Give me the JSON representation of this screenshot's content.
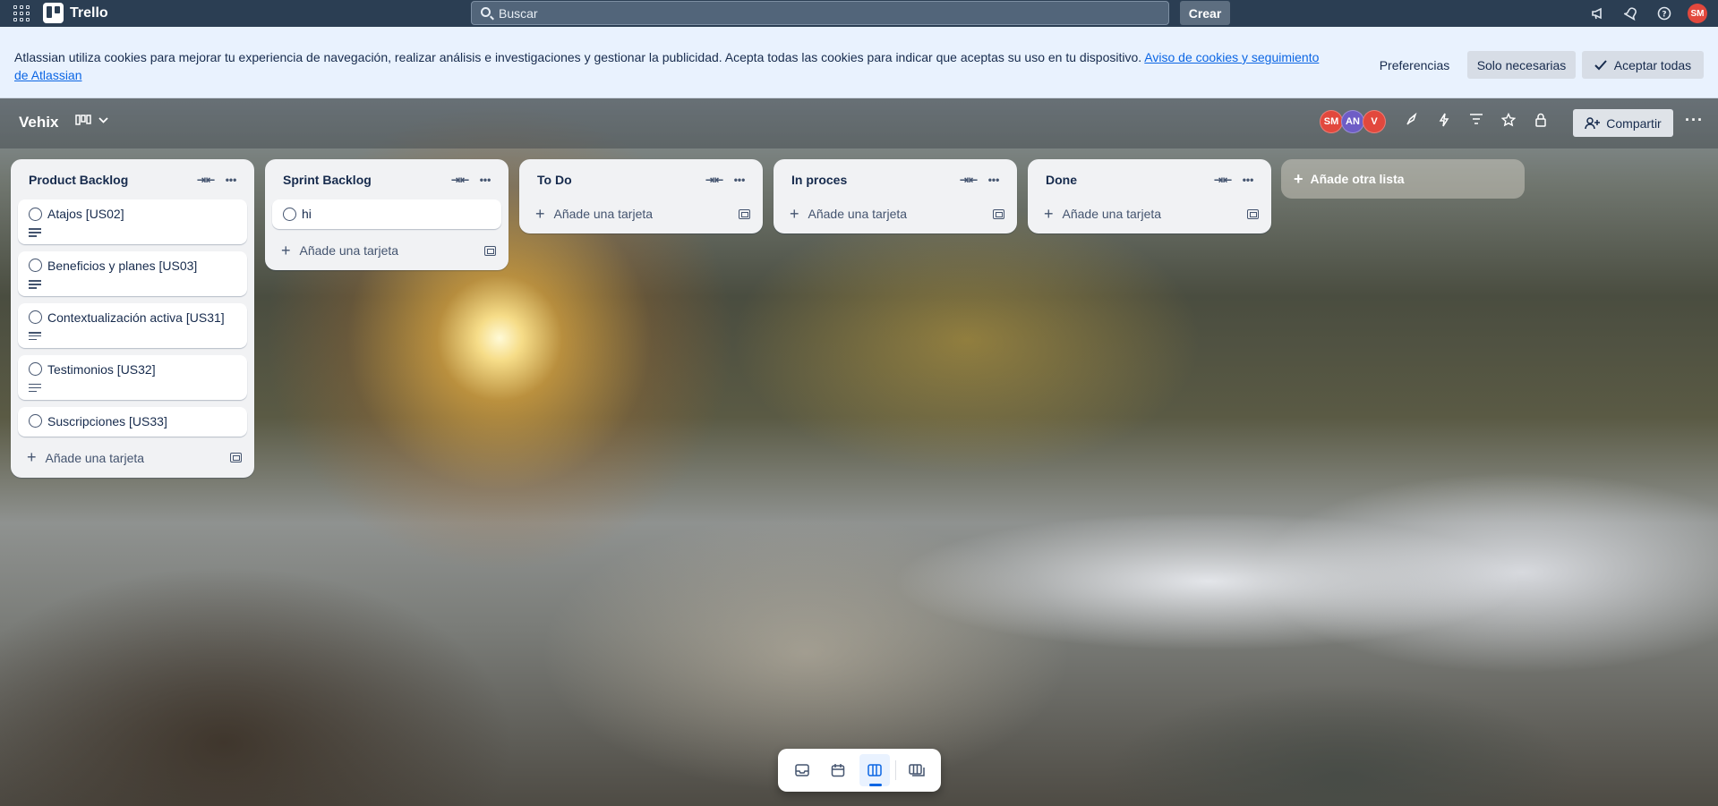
{
  "app": {
    "name": "Trello"
  },
  "search": {
    "placeholder": "Buscar"
  },
  "create_label": "Crear",
  "user_initials": "SM",
  "cookie": {
    "text": "Atlassian utiliza cookies para mejorar tu experiencia de navegación, realizar análisis e investigaciones y gestionar la publicidad. Acepta todas las cookies para indicar que aceptas su uso en tu dispositivo.",
    "link": "Aviso de cookies y seguimiento de Atlassian",
    "preferences": "Preferencias",
    "necessary": "Solo necesarias",
    "accept_all": "Aceptar todas"
  },
  "board": {
    "title": "Vehix",
    "members": [
      {
        "initials": "SM",
        "color": "#e2483d"
      },
      {
        "initials": "AN",
        "color": "#6e5dc6"
      },
      {
        "initials": "V",
        "color": "#e2483d"
      }
    ],
    "share_label": "Compartir"
  },
  "lists": [
    {
      "title": "Product Backlog",
      "cards": [
        {
          "title": "Atajos [US02]",
          "has_description": true
        },
        {
          "title": "Beneficios y planes [US03]",
          "has_description": true
        },
        {
          "title": "Contextualización activa [US31]",
          "has_description": true
        },
        {
          "title": "Testimonios [US32]",
          "has_description": true
        },
        {
          "title": "Suscripciones [US33]",
          "has_description": false
        }
      ],
      "add_card": "Añade una tarjeta"
    },
    {
      "title": "Sprint Backlog",
      "cards": [
        {
          "title": "hi",
          "has_description": false
        }
      ],
      "add_card": "Añade una tarjeta"
    },
    {
      "title": "To Do",
      "cards": [],
      "add_card": "Añade una tarjeta"
    },
    {
      "title": "In proces",
      "cards": [],
      "add_card": "Añade una tarjeta"
    },
    {
      "title": "Done",
      "cards": [],
      "add_card": "Añade una tarjeta"
    }
  ],
  "add_list": "Añade otra lista",
  "colors": {
    "topnav": "#2b3e53",
    "accent": "#0c66e4",
    "list_bg": "#f1f2f4"
  }
}
